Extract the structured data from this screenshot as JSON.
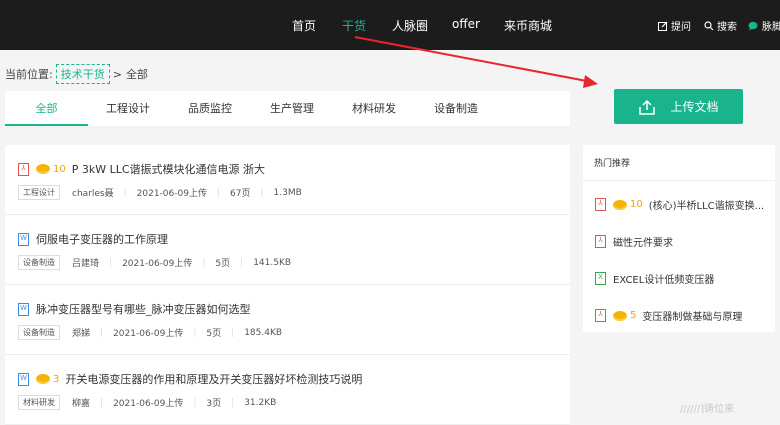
{
  "topnav": {
    "links": [
      "首页",
      "干货",
      "人脉圈",
      "offer",
      "来币商城"
    ],
    "tools": [
      "提问",
      "搜索",
      "脉脚"
    ]
  },
  "breadcrumb": {
    "prefix": "当前位置:",
    "link": "技术干货",
    "separator": ">",
    "current": "全部"
  },
  "tabs": [
    "全部",
    "工程设计",
    "品质监控",
    "生产管理",
    "材料研发",
    "设备制造"
  ],
  "upload": {
    "label": "上传文档"
  },
  "docs": [
    {
      "type": "pdf",
      "coins": "10",
      "title": "P 3kW LLC谐振式模块化通信电源 浙大",
      "tag": "工程设计",
      "author": "charles聂",
      "date": "2021-06-09上传",
      "pages": "67页",
      "size": "1.3MB"
    },
    {
      "type": "word",
      "coins": "",
      "title": "伺服电子变压器的工作原理",
      "tag": "设备制造",
      "author": "吕建琦",
      "date": "2021-06-09上传",
      "pages": "5页",
      "size": "141.5KB"
    },
    {
      "type": "word",
      "coins": "",
      "title": "脉冲变压器型号有哪些_脉冲变压器如何选型",
      "tag": "设备制造",
      "author": "郑娣",
      "date": "2021-06-09上传",
      "pages": "5页",
      "size": "185.4KB"
    },
    {
      "type": "word",
      "coins": "3",
      "title": "开关电源变压器的作用和原理及开关变压器好坏检测技巧说明",
      "tag": "材料研发",
      "author": "柳嘉",
      "date": "2021-06-09上传",
      "pages": "3页",
      "size": "31.2KB"
    }
  ],
  "sidebar": {
    "title": "热门推荐",
    "items": [
      {
        "type": "pdf",
        "coins": "10",
        "title": "(核心)半桥LLC谐振变换..."
      },
      {
        "type": "pdf",
        "coins": "",
        "title": "磁性元件要求"
      },
      {
        "type": "excel",
        "coins": "",
        "title": "EXCEL设计低频变压器"
      },
      {
        "type": "pdf",
        "coins": "5",
        "title": "变压器制做基础与原理"
      }
    ]
  },
  "file_icon_letters": {
    "pdf": "⅄",
    "word": "W",
    "excel": "X"
  },
  "watermark": "//////]铸位来",
  "colors": {
    "accent": "#19b48c",
    "nav_bg": "#1c1c1c",
    "arrow": "#e8262b",
    "coin": "#f5b400"
  }
}
